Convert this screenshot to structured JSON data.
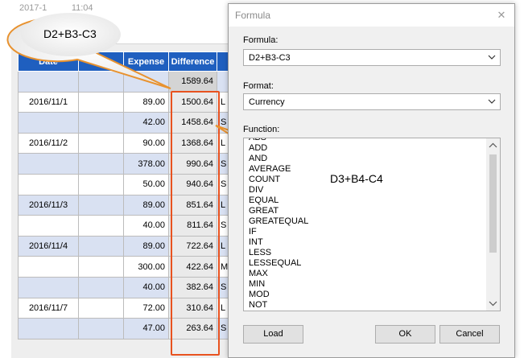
{
  "document": {
    "header_date": "2017-1          11:04",
    "table": {
      "headers": [
        "Date",
        "ne",
        "Expense",
        "Difference",
        ""
      ],
      "rows": [
        {
          "date": "",
          "income": "",
          "expense": "",
          "difference": "1589.64",
          "desc": ""
        },
        {
          "date": "2016/11/1",
          "income": "",
          "expense": "89.00",
          "difference": "1500.64",
          "desc": "L"
        },
        {
          "date": "",
          "income": "",
          "expense": "42.00",
          "difference": "1458.64",
          "desc": "S"
        },
        {
          "date": "2016/11/2",
          "income": "",
          "expense": "90.00",
          "difference": "1368.64",
          "desc": "L"
        },
        {
          "date": "",
          "income": "",
          "expense": "378.00",
          "difference": "990.64",
          "desc": "S"
        },
        {
          "date": "",
          "income": "",
          "expense": "50.00",
          "difference": "940.64",
          "desc": "S"
        },
        {
          "date": "2016/11/3",
          "income": "",
          "expense": "89.00",
          "difference": "851.64",
          "desc": "L"
        },
        {
          "date": "",
          "income": "",
          "expense": "40.00",
          "difference": "811.64",
          "desc": "S"
        },
        {
          "date": "2016/11/4",
          "income": "",
          "expense": "89.00",
          "difference": "722.64",
          "desc": "L"
        },
        {
          "date": "",
          "income": "",
          "expense": "300.00",
          "difference": "422.64",
          "desc": "M"
        },
        {
          "date": "",
          "income": "",
          "expense": "40.00",
          "difference": "382.64",
          "desc": "S"
        },
        {
          "date": "2016/11/7",
          "income": "",
          "expense": "72.00",
          "difference": "310.64",
          "desc": "L"
        },
        {
          "date": "",
          "income": "",
          "expense": "47.00",
          "difference": "263.64",
          "desc": "S"
        }
      ]
    }
  },
  "callouts": {
    "first": "D2+B3-C3",
    "second": "D3+B4-C4"
  },
  "dialog": {
    "title": "Formula",
    "close_glyph": "✕",
    "formula_label": "Formula:",
    "formula_value": "D2+B3-C3",
    "format_label": "Format:",
    "format_value": "Currency",
    "function_label": "Function:",
    "functions": [
      "ABS",
      "ADD",
      "AND",
      "AVERAGE",
      "COUNT",
      "DIV",
      "EQUAL",
      "GREAT",
      "GREATEQUAL",
      "IF",
      "INT",
      "LESS",
      "LESSEQUAL",
      "MAX",
      "MIN",
      "MOD",
      "NOT"
    ],
    "load_label": "Load",
    "ok_label": "OK",
    "cancel_label": "Cancel"
  },
  "colors": {
    "header_blue": "#1f5fbf",
    "row_blue": "#d9e1f2",
    "highlight_red": "#e8521f",
    "callout_border": "#e8922f"
  }
}
